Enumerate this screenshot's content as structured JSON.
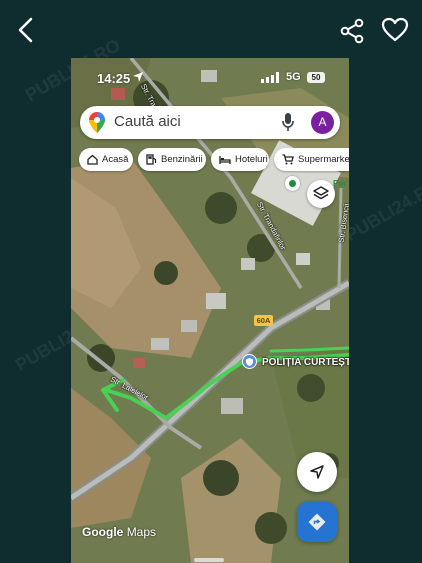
{
  "viewer": {
    "back_icon": "chevron-left-icon",
    "share_icon": "share-icon",
    "favorite_icon": "heart-outline-icon",
    "background": "#0f2c2f"
  },
  "status_bar": {
    "time": "14:25",
    "network": "5G",
    "battery": "50"
  },
  "search": {
    "placeholder": "Caută aici",
    "avatar_letter": "A"
  },
  "chips": [
    {
      "label": "Acasă",
      "icon": "home-icon"
    },
    {
      "label": "Benzinării",
      "icon": "fuel-pump-icon"
    },
    {
      "label": "Hoteluri",
      "icon": "bed-icon"
    },
    {
      "label": "Supermarketu",
      "icon": "shopping-cart-icon"
    }
  ],
  "map": {
    "labels": {
      "trandafirilor_top": "Str. Trandafirilor",
      "trandafirilor": "Str. Trandafirilor",
      "biserici": "Str. Bisericii",
      "lalelelor": "Str. Lalelelor"
    },
    "road_shield": "60A",
    "poi_name": "POLIȚIA CURTEȘTI",
    "store_fragment": "Por",
    "annotation_color": "#49d155",
    "brand": {
      "google": "Google",
      "maps": "Maps"
    }
  },
  "watermark": "PUBLI24.RO"
}
